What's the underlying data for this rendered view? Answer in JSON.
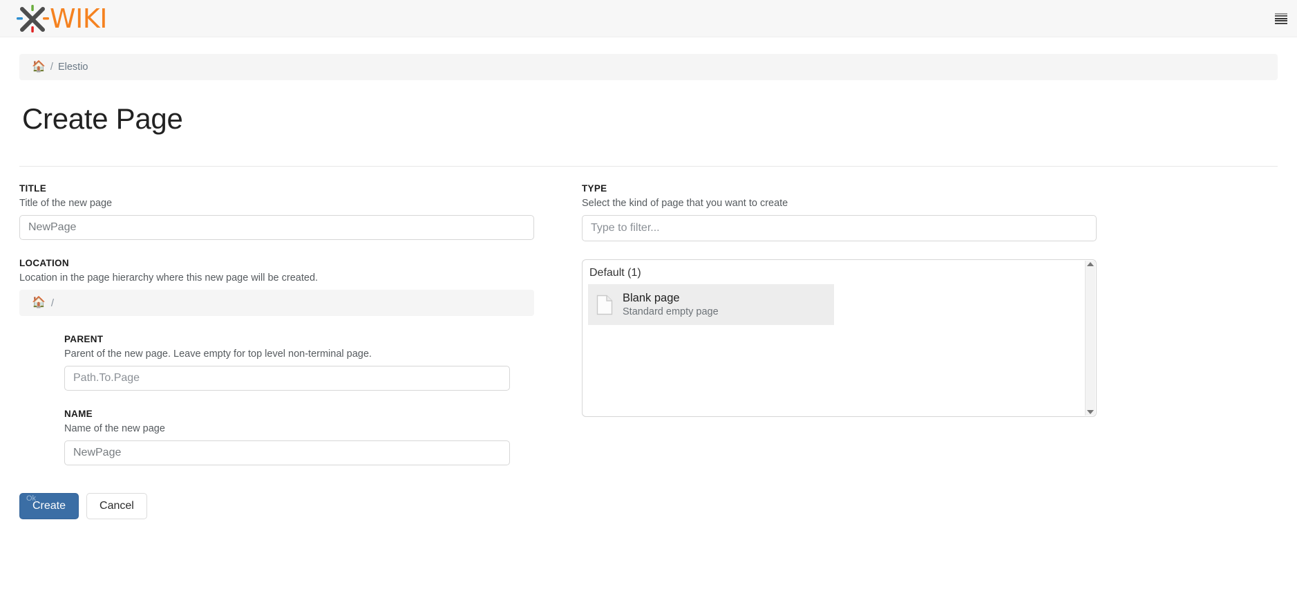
{
  "topbar": {
    "logo_text": "WIKI",
    "logo_icon": "xwiki-logo-x",
    "menu_icon": "hamburger-menu-icon"
  },
  "breadcrumb": {
    "home_icon": "🏠",
    "separator": "/",
    "current": "Elestio"
  },
  "page": {
    "title": "Create Page"
  },
  "form": {
    "title_field": {
      "label": "TITLE",
      "hint": "Title of the new page",
      "value": "NewPage",
      "placeholder": "NewPage"
    },
    "location_field": {
      "label": "LOCATION",
      "hint": "Location in the page hierarchy where this new page will be created.",
      "home_icon": "🏠",
      "separator": "/"
    },
    "parent_field": {
      "label": "PARENT",
      "hint": "Parent of the new page. Leave empty for top level non-terminal page.",
      "placeholder": "Path.To.Page",
      "value": ""
    },
    "name_field": {
      "label": "NAME",
      "hint": "Name of the new page",
      "value": "NewPage",
      "placeholder": "NewPage"
    },
    "type_field": {
      "label": "TYPE",
      "hint": "Select the kind of page that you want to create",
      "placeholder": "Type to filter...",
      "value": ""
    }
  },
  "templates": {
    "group_title": "Default (1)",
    "items": [
      {
        "name": "Blank page",
        "description": "Standard empty page",
        "icon": "document-page-icon",
        "selected": true
      }
    ]
  },
  "actions": {
    "create_label": "Create",
    "create_accesskey_hint": "Ok",
    "cancel_label": "Cancel"
  },
  "colors": {
    "primary": "#3b6ea5",
    "brand_orange": "#f58220",
    "logo_dark": "#4d4d4d",
    "selected_row": "#ededed"
  }
}
